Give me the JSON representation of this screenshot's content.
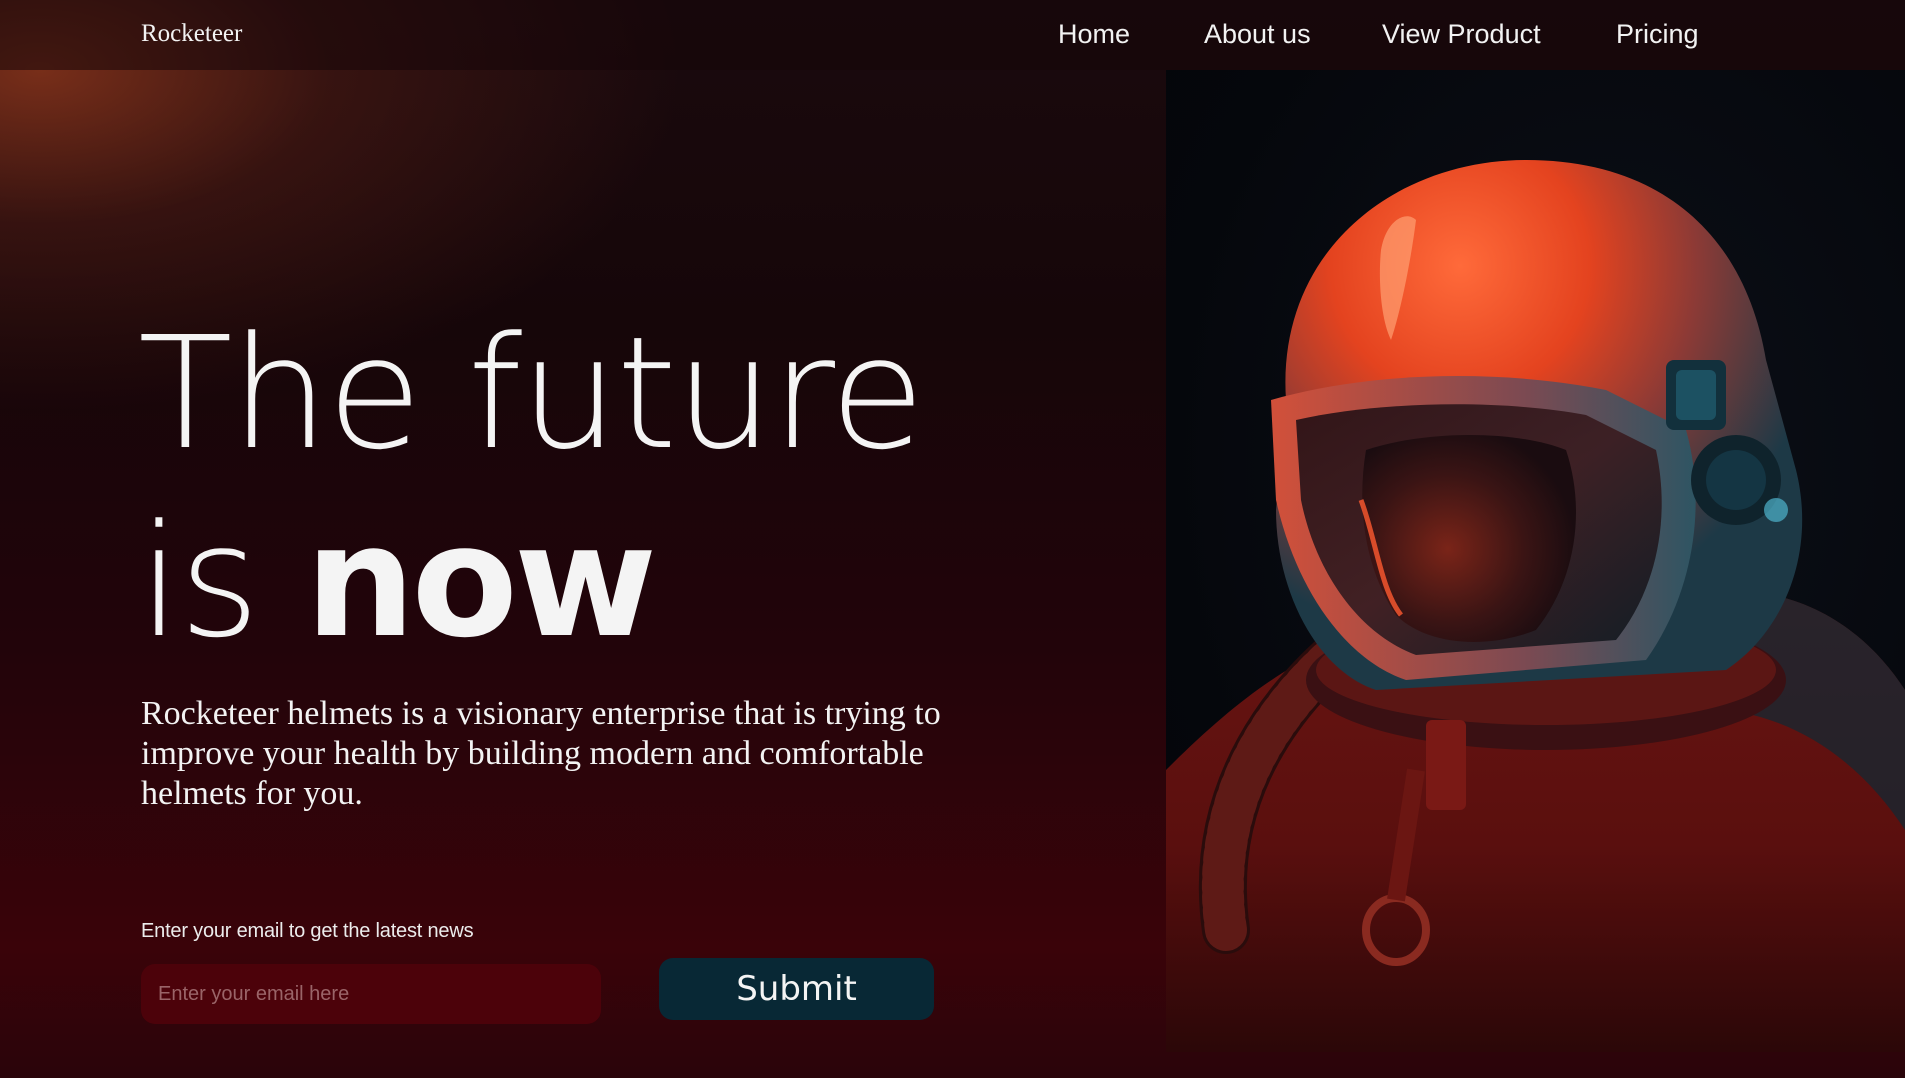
{
  "navbar": {
    "brand": "Rocketeer",
    "links": [
      "Home",
      "About us",
      "View Product",
      "Pricing"
    ]
  },
  "hero": {
    "title_line1": "The future",
    "title_line2_light": "is",
    "title_line2_bold": "now",
    "description": "Rocketeer helmets is a visionary enterprise that is trying to improve your health by building modern and comfortable helmets for you."
  },
  "signup": {
    "label": "Enter your email to get the latest news",
    "placeholder": "Enter your email here",
    "submit_label": "Submit"
  },
  "image": {
    "subject": "astronaut-helmet-photo"
  },
  "colors": {
    "accent_dark_red": "#4c020a",
    "button_teal": "#082835",
    "text": "#f4f4f4"
  }
}
